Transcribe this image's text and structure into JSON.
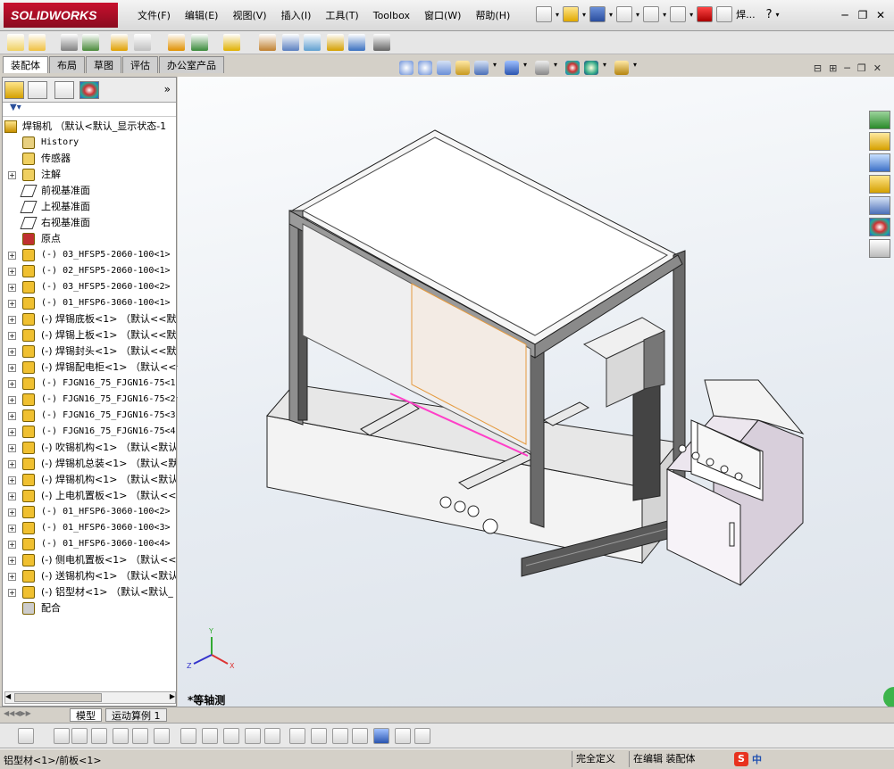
{
  "app": {
    "logo_text": "SOLIDWORKS",
    "menu": [
      "文件(F)",
      "编辑(E)",
      "视图(V)",
      "插入(I)",
      "工具(T)",
      "Toolbox",
      "窗口(W)",
      "帮助(H)"
    ],
    "title_short": "焊...",
    "help_glyph": "?"
  },
  "command_tabs": [
    "装配体",
    "布局",
    "草图",
    "评估",
    "办公室产品"
  ],
  "feature_tree": {
    "root": "焊锡机 （默认<默认_显示状态-1",
    "items": [
      {
        "label": "History",
        "type": "history",
        "expand": false,
        "mono": true
      },
      {
        "label": "传感器",
        "type": "sensor",
        "expand": false
      },
      {
        "label": "注解",
        "type": "annotation",
        "expand": true
      },
      {
        "label": "前视基准面",
        "type": "plane",
        "expand": false
      },
      {
        "label": "上视基准面",
        "type": "plane",
        "expand": false
      },
      {
        "label": "右视基准面",
        "type": "plane",
        "expand": false
      },
      {
        "label": "原点",
        "type": "origin",
        "expand": false
      },
      {
        "label": "(-) 03_HFSP5-2060-100<1>",
        "type": "part",
        "expand": true,
        "mono": true
      },
      {
        "label": "(-) 02_HFSP5-2060-100<1>",
        "type": "part",
        "expand": true,
        "mono": true
      },
      {
        "label": "(-) 03_HFSP5-2060-100<2>",
        "type": "part",
        "expand": true,
        "mono": true
      },
      {
        "label": "(-) 01_HFSP6-3060-100<1>",
        "type": "part",
        "expand": true,
        "mono": true
      },
      {
        "label": "(-) 焊锡底板<1> （默认<<默",
        "type": "part",
        "expand": true
      },
      {
        "label": "(-) 焊锡上板<1> （默认<<默",
        "type": "part",
        "expand": true
      },
      {
        "label": "(-) 焊锡封头<1> （默认<<默",
        "type": "part",
        "expand": true
      },
      {
        "label": "(-) 焊锡配电柜<1> （默认<<",
        "type": "part",
        "expand": true
      },
      {
        "label": "(-) FJGN16_75_FJGN16-75<1",
        "type": "part",
        "expand": true,
        "mono": true
      },
      {
        "label": "(-) FJGN16_75_FJGN16-75<2",
        "type": "part",
        "expand": true,
        "mono": true
      },
      {
        "label": "(-) FJGN16_75_FJGN16-75<3",
        "type": "part",
        "expand": true,
        "mono": true
      },
      {
        "label": "(-) FJGN16_75_FJGN16-75<4",
        "type": "part",
        "expand": true,
        "mono": true
      },
      {
        "label": "(-) 吹锡机构<1> （默认<默认",
        "type": "asm",
        "expand": true
      },
      {
        "label": "(-) 焊锡机总装<1> （默认<默",
        "type": "asm",
        "expand": true
      },
      {
        "label": "(-) 焊锡机构<1> （默认<默认",
        "type": "asm",
        "expand": true
      },
      {
        "label": "(-) 上电机置板<1> （默认<<",
        "type": "part",
        "expand": true
      },
      {
        "label": "(-) 01_HFSP6-3060-100<2>",
        "type": "part",
        "expand": true,
        "mono": true
      },
      {
        "label": "(-) 01_HFSP6-3060-100<3>",
        "type": "part",
        "expand": true,
        "mono": true
      },
      {
        "label": "(-) 01_HFSP6-3060-100<4>",
        "type": "part",
        "expand": true,
        "mono": true
      },
      {
        "label": "(-) 侧电机置板<1> （默认<<",
        "type": "part",
        "expand": true
      },
      {
        "label": "(-) 送锡机构<1> （默认<默认",
        "type": "asm",
        "expand": true
      },
      {
        "label": "(-) 铝型材<1> （默认<默认_",
        "type": "part",
        "expand": true
      },
      {
        "label": "配合",
        "type": "mates",
        "expand": false
      }
    ]
  },
  "viewport": {
    "view_name": "*等轴测",
    "triad": {
      "x": "X",
      "y": "Y",
      "z": "Z"
    }
  },
  "bottom_tabs": [
    "模型",
    "运动算例 1"
  ],
  "status": {
    "selection": "铝型材<1>/前板<1>",
    "definition": "完全定义",
    "mode": "在编辑 装配体",
    "ime": "中"
  },
  "colors": {
    "accent": "#c8102e",
    "selection": "#ff40c8",
    "cabinet": "#f4eef6"
  }
}
